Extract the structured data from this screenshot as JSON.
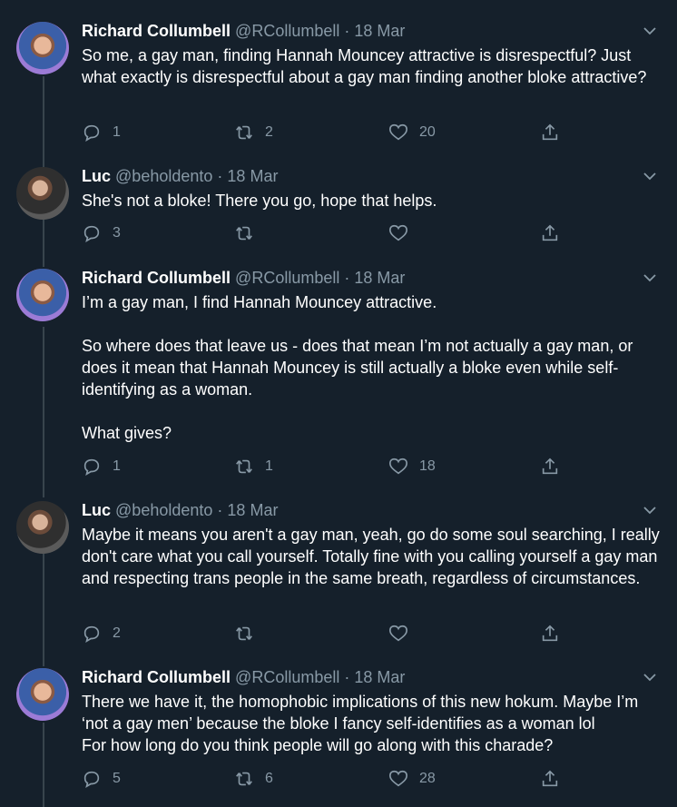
{
  "tweets": [
    {
      "name": "Richard Collumbell",
      "handle": "@RCollumbell",
      "date": "18 Mar",
      "text": "So me, a gay man, finding Hannah Mouncey attractive is disrespectful? Just what exactly is disrespectful about a gay man finding another bloke attractive?",
      "replies": "1",
      "retweets": "2",
      "likes": "20"
    },
    {
      "name": "Luc",
      "handle": "@beholdento",
      "date": "18 Mar",
      "text": "She's not a bloke! There you go, hope that helps.",
      "replies": "3",
      "retweets": "",
      "likes": ""
    },
    {
      "name": "Richard Collumbell",
      "handle": "@RCollumbell",
      "date": "18 Mar",
      "text": "I’m a gay man, I find Hannah Mouncey attractive.\n\nSo where does that leave us - does that mean I’m not actually a gay man, or does it mean that Hannah Mouncey is still actually a bloke even while self-identifying as a woman.\n\nWhat gives?",
      "replies": "1",
      "retweets": "1",
      "likes": "18"
    },
    {
      "name": "Luc",
      "handle": "@beholdento",
      "date": "18 Mar",
      "text": "Maybe it means you aren't a gay man, yeah, go do some soul searching, I really don't care what you call yourself. Totally fine with you calling yourself a gay man and respecting trans people in the same breath, regardless of circumstances.",
      "replies": "2",
      "retweets": "",
      "likes": ""
    },
    {
      "name": "Richard Collumbell",
      "handle": "@RCollumbell",
      "date": "18 Mar",
      "text": "There we have it, the homophobic implications of this new hokum. Maybe I’m ‘not a gay men’ because the bloke I fancy self-identifies as a woman lol\nFor how long do you think people will go along with this charade?",
      "replies": "5",
      "retweets": "6",
      "likes": "28"
    }
  ],
  "separator": "·",
  "icons": [
    "reply-icon",
    "retweet-icon",
    "like-icon",
    "share-icon",
    "chevron-down-icon"
  ],
  "colors": {
    "background": "#15202b",
    "muted": "#8899a6",
    "thread_line": "#38444d"
  }
}
